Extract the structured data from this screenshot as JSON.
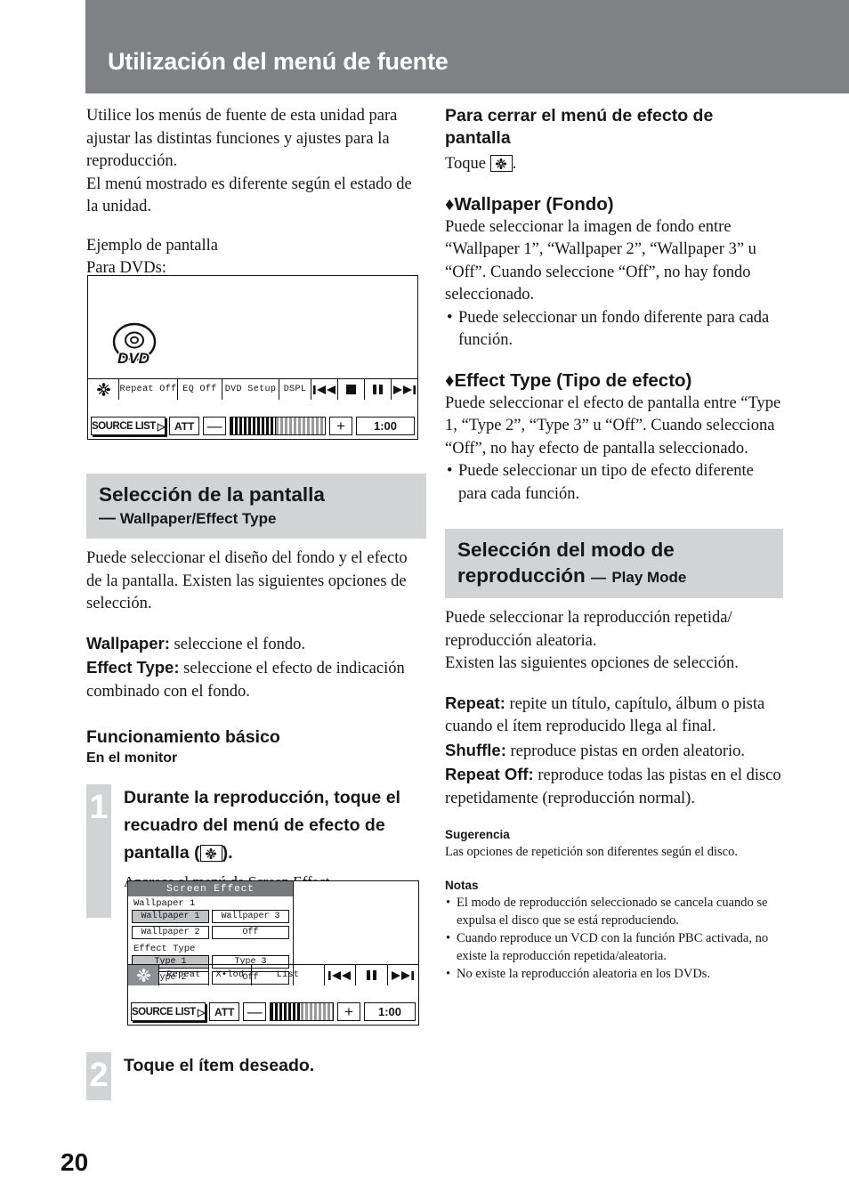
{
  "header": {
    "title": "Utilización del menú de fuente"
  },
  "page_number": "20",
  "left": {
    "intro": [
      "Utilice los menús de fuente de esta unidad para ajustar las distintas funciones y ajustes para la reproducción.",
      "El menú mostrado es diferente según el estado de la unidad."
    ],
    "example_label": "Ejemplo de pantalla",
    "example_sub": "Para DVDs:",
    "section1": {
      "title": "Selección de la pantalla",
      "subtitle_dash": "—",
      "subtitle": "Wallpaper/Effect Type",
      "paragraph": "Puede seleccionar el diseño del fondo y el efecto de la pantalla. Existen las siguientes opciones de selección.",
      "item1_label": "Wallpaper:",
      "item1_text": " seleccione el fondo.",
      "item2_label": "Effect Type:",
      "item2_text": " seleccione el efecto de indicación combinado con el fondo."
    },
    "basic_heading": "Funcionamiento básico",
    "basic_sub": "En el monitor",
    "step1": {
      "num": "1",
      "text_a": "Durante la reproducción, toque el recuadro del menú de efecto de pantalla (",
      "text_b": ").",
      "desc": "Aparece el menú de Screen Effect."
    },
    "step2": {
      "num": "2",
      "text": "Toque el ítem deseado."
    }
  },
  "right": {
    "close_heading": "Para cerrar el menú de efecto de pantalla",
    "close_text_a": "Toque ",
    "close_text_b": ".",
    "wallpaper": {
      "diamond": "♦",
      "heading": "Wallpaper (Fondo)",
      "paragraph": "Puede seleccionar la imagen de fondo entre “Wallpaper 1”, “Wallpaper 2”, “Wallpaper 3” u “Off”. Cuando seleccione “Off”, no hay fondo seleccionado.",
      "bullet": "Puede seleccionar un fondo diferente para cada función."
    },
    "effect": {
      "diamond": "♦",
      "heading": "Effect Type (Tipo de efecto)",
      "paragraph": "Puede seleccionar el efecto de pantalla entre “Type 1, “Type 2”, “Type 3” u “Off”. Cuando selecciona “Off”, no hay efecto de pantalla seleccionado.",
      "bullet": "Puede seleccionar un tipo de efecto diferente para cada función."
    },
    "section2": {
      "title": "Selección del modo de reproducción",
      "subtitle_dash": "—",
      "subtitle": "Play Mode",
      "paragraph1": "Puede seleccionar la reproducción repetida/ reproducción aleatoria.",
      "paragraph2": "Existen las siguientes opciones de selección.",
      "repeat_label": "Repeat:",
      "repeat_text": " repite un título, capítulo, álbum o pista cuando el ítem reproducido llega al final.",
      "shuffle_label": "Shuffle:",
      "shuffle_text": " reproduce pistas en orden aleatorio.",
      "repeatoff_label": "Repeat  Off:",
      "repeatoff_text": " reproduce todas las pistas en el disco repetidamente (reproducción normal)."
    },
    "tip": {
      "heading": "Sugerencia",
      "text": "Las opciones de repetición son diferentes según el disco."
    },
    "notes": {
      "heading": "Notas",
      "items": [
        "El modo de reproducción seleccionado se cancela cuando se expulsa el disco que se está reproduciendo.",
        "Cuando reproduce un VCD con la función PBC activada, no existe la reproducción repetida/aleatoria.",
        "No existe la reproducción aleatoria en los DVDs."
      ]
    }
  },
  "lcd_dvd": {
    "disc_label": "DVD",
    "toolbar": [
      {
        "label": "",
        "icon": "screen-effect-icon"
      },
      {
        "label": "Repeat Off"
      },
      {
        "label": "EQ Off"
      },
      {
        "label": "DVD Setup"
      },
      {
        "label": "DSPL"
      },
      {
        "label": "◀◀",
        "icon": "prev-track-icon"
      },
      {
        "label": "■",
        "icon": "stop-icon"
      },
      {
        "label": "❚❚",
        "icon": "pause-icon"
      },
      {
        "label": "▶▶",
        "icon": "next-track-icon"
      }
    ],
    "source_list": "SOURCE LIST",
    "att": "ATT",
    "minus": "—",
    "plus": "+",
    "time": "1:00"
  },
  "lcd_screen_effect": {
    "title": "Screen Effect",
    "group1_label": "Wallpaper 1",
    "group1_buttons": [
      {
        "label": "Wallpaper 1",
        "selected": true
      },
      {
        "label": "Wallpaper 3",
        "selected": false
      },
      {
        "label": "Wallpaper 2",
        "selected": false
      },
      {
        "label": "Off",
        "selected": false
      }
    ],
    "group2_label": "Effect Type",
    "group2_buttons": [
      {
        "label": "Type  1",
        "selected": true
      },
      {
        "label": "Type  3",
        "selected": false
      },
      {
        "label": "Type  2",
        "selected": false
      },
      {
        "label": "Off",
        "selected": false
      }
    ],
    "toolbar": [
      {
        "label": "",
        "icon": "screen-effect-icon"
      },
      {
        "label": "Repeat"
      },
      {
        "label": "X•lod"
      },
      {
        "label": "List"
      },
      {
        "label": "◀◀",
        "icon": "prev-track-icon"
      },
      {
        "label": "❚❚",
        "icon": "pause-icon"
      },
      {
        "label": "▶▶",
        "icon": "next-track-icon"
      }
    ],
    "source_list": "SOURCE LIST",
    "att": "ATT",
    "minus": "—",
    "plus": "+",
    "time": "1:00"
  },
  "colors": {
    "header_band": "#7f8185",
    "section_box": "#d2d3d4",
    "step_num_box": "#d2d3d4",
    "lcd_title_bar": "#77797d",
    "lcd_selected": "#c0c2c4"
  }
}
